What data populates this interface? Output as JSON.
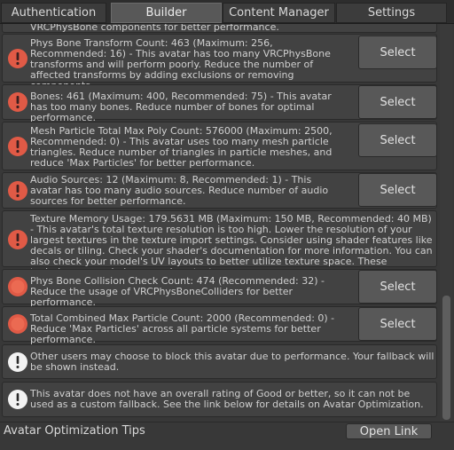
{
  "tabs": [
    {
      "label": "Authentication"
    },
    {
      "label": "Builder"
    },
    {
      "label": "Content Manager"
    },
    {
      "label": "Settings"
    }
  ],
  "rows": [
    {
      "icon": "error-icon",
      "text": "VRCPhysBone components for better performance.",
      "button": ""
    },
    {
      "icon": "error-icon",
      "text": "Phys Bone Transform Count: 463 (Maximum: 256, Recommended: 16) - This avatar has too many VRCPhysBone transforms and will perform poorly. Reduce the number of affected transforms by adding exclusions or removing components.",
      "button": "Select"
    },
    {
      "icon": "error-icon",
      "text": "Bones: 461 (Maximum: 400, Recommended: 75) - This avatar has too many bones. Reduce number of bones for optimal performance.",
      "button": "Select"
    },
    {
      "icon": "error-icon",
      "text": "Mesh Particle Total Max Poly Count: 576000 (Maximum: 2500, Recommended: 0) - This avatar uses too many mesh particle triangles. Reduce number of triangles in particle meshes, and reduce 'Max Particles' for better performance.",
      "button": "Select"
    },
    {
      "icon": "error-icon",
      "text": "Audio Sources: 12 (Maximum: 8, Recommended: 1) - This avatar has too many audio sources. Reduce number of audio sources for better performance.",
      "button": "Select"
    },
    {
      "icon": "error-icon",
      "text": "Texture Memory Usage: 179.5631 MB (Maximum: 150 MB, Recommended: 40 MB) - This avatar's total texture resolution is too high. Lower the resolution of your largest textures in the texture import settings. Consider using shader features like decals or tiling. Check your shader's documentation for more information. You can also check your model's UV layouts to better utilize texture space. These techniques may help you reduce texture memory usage.",
      "button": ""
    },
    {
      "icon": "warning-circle-icon",
      "text": "Phys Bone Collision Check Count: 474 (Recommended: 32) - Reduce the usage of VRCPhysBoneColliders for better performance.",
      "button": "Select"
    },
    {
      "icon": "warning-circle-icon",
      "text": "Total Combined Max Particle Count: 2000 (Recommended: 0) - Reduce 'Max Particles' across all particle systems for better performance.",
      "button": "Select"
    },
    {
      "icon": "info-icon",
      "text": "Other users may choose to block this avatar due to performance. Your fallback will be shown instead.",
      "button": ""
    },
    {
      "icon": "info-icon",
      "text": "This avatar does not have an overall rating of Good or better, so it can not be used as a custom fallback. See the link below for details on Avatar Optimization.",
      "button": ""
    }
  ],
  "footer": {
    "label": "Avatar Optimization Tips",
    "button": "Open Link"
  },
  "colors": {
    "error": "#e05a46",
    "info_bg": "#f2f2f2"
  }
}
